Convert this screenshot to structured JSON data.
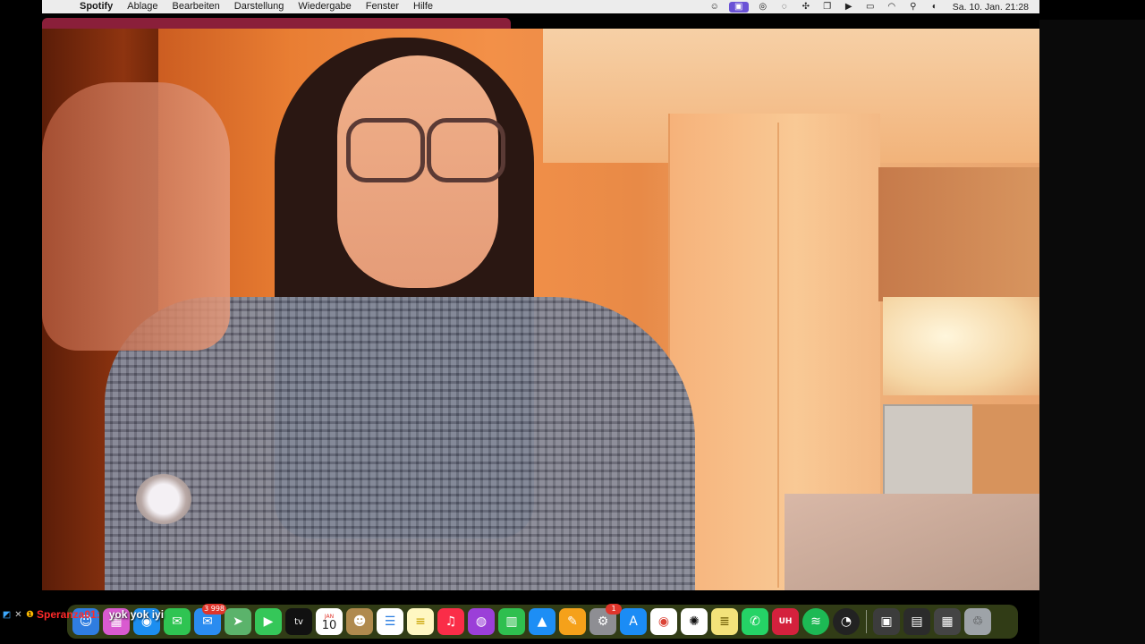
{
  "menubar": {
    "app_name": "Spotify",
    "menus": [
      "Ablage",
      "Bearbeiten",
      "Darstellung",
      "Wiedergabe",
      "Fenster",
      "Hilfe"
    ],
    "clock": "Sa. 10. Jan. 21:28"
  },
  "dock": {
    "mail_badge": "3 998",
    "settings_badge": "1",
    "calendar_month": "JAN",
    "calendar_day": "10",
    "tv_label": "tv"
  },
  "overlay": {
    "username": "Speranza01:",
    "message": "yok yok iyi"
  },
  "colors": {
    "accent": "#6a52d6",
    "username": "#ff2a2a",
    "window_strip": "#8a1f3a"
  }
}
